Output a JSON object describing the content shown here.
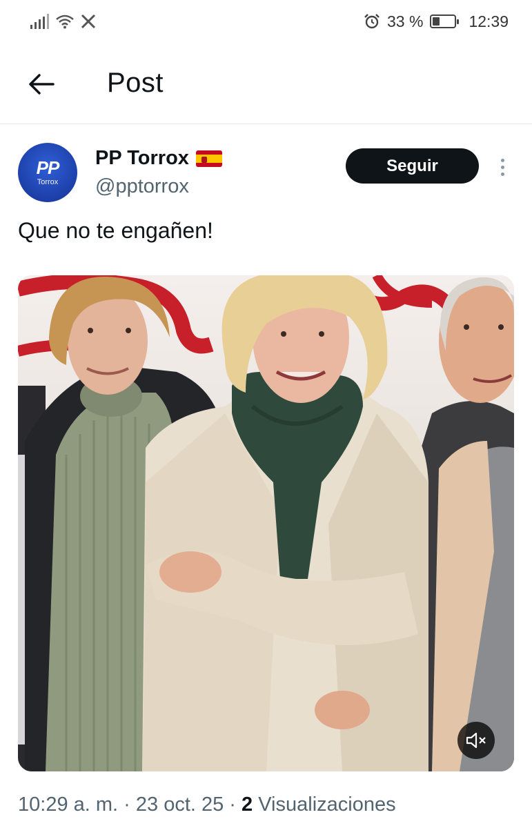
{
  "status_bar": {
    "battery_text": "33 %",
    "battery_level": 0.33,
    "time": "12:39",
    "icons": [
      "signal-icon",
      "wifi-icon",
      "x-app-icon",
      "alarm-icon",
      "battery-icon"
    ]
  },
  "header": {
    "title": "Post"
  },
  "post": {
    "author_name": "PP Torrox",
    "author_handle": "@pptorrox",
    "avatar_text": "PP",
    "avatar_subtext": "Torrox",
    "follow_label": "Seguir",
    "text": "Que no te engañen!",
    "meta": {
      "time": "10:29 a. m.",
      "sep1": " · ",
      "date": "23 oct. 25",
      "sep2": " · ",
      "views_count": "2",
      "views_label": " Visualizaciones"
    }
  },
  "colors": {
    "follow_bg": "#0f1419",
    "secondary_text": "#536471",
    "avatar_blue": "#1d3fa8",
    "banner_red": "#c8202a"
  }
}
